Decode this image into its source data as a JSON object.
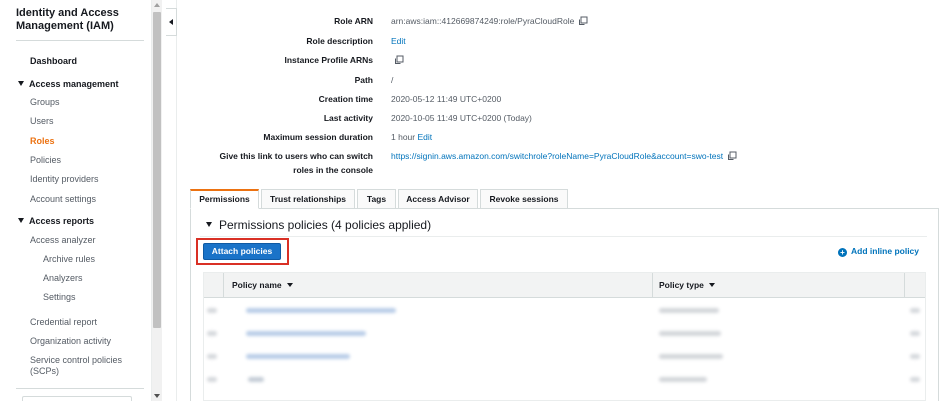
{
  "sidebar": {
    "title": "Identity and Access Management (IAM)",
    "dashboard": "Dashboard",
    "access_management": {
      "label": "Access management",
      "items": [
        "Groups",
        "Users",
        "Roles",
        "Policies",
        "Identity providers",
        "Account settings"
      ],
      "active": "Roles"
    },
    "access_reports": {
      "label": "Access reports",
      "access_analyzer": "Access analyzer",
      "sub_items": [
        "Archive rules",
        "Analyzers",
        "Settings"
      ],
      "items": [
        "Credential report",
        "Organization activity",
        "Service control policies (SCPs)"
      ]
    }
  },
  "summary": {
    "role_arn_label": "Role ARN",
    "role_arn_value": "arn:aws:iam::412669874249:role/PyraCloudRole",
    "role_description_label": "Role description",
    "role_description_link": "Edit",
    "instance_profile_label": "Instance Profile ARNs",
    "path_label": "Path",
    "path_value": "/",
    "creation_time_label": "Creation time",
    "creation_time_value": "2020-05-12 11:49 UTC+0200",
    "last_activity_label": "Last activity",
    "last_activity_value": "2020-10-05 11:49 UTC+0200 (Today)",
    "max_session_label": "Maximum session duration",
    "max_session_value": "1 hour",
    "max_session_link": "Edit",
    "switch_link_label_1": "Give this link to users who can switch",
    "switch_link_label_2": "roles in the console",
    "switch_link_value": "https://signin.aws.amazon.com/switchrole?roleName=PyraCloudRole&account=swo-test"
  },
  "tabs": [
    "Permissions",
    "Trust relationships",
    "Tags",
    "Access Advisor",
    "Revoke sessions"
  ],
  "permissions": {
    "header": "Permissions policies (4 policies applied)",
    "attach_button": "Attach policies",
    "add_inline": "Add inline policy",
    "columns": [
      "Policy name",
      "Policy type"
    ]
  },
  "colors": {
    "accent_orange": "#ec7211",
    "link_blue": "#0073bb",
    "button_blue": "#1a73c8",
    "highlight_red": "#d93025"
  }
}
